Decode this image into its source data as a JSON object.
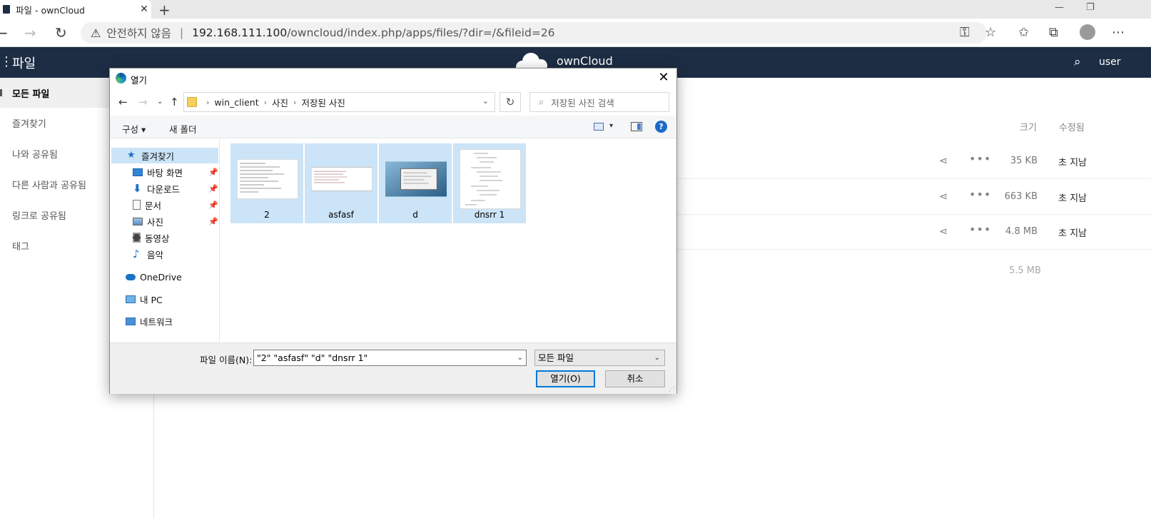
{
  "browser": {
    "tab_title": "파일 - ownCloud",
    "close_tab": "✕",
    "new_tab": "+",
    "security_label": "안전하지 않음",
    "url_host": "192.168.111.100",
    "url_path": "/owncloud/index.php/apps/files/?dir=/&fileid=26"
  },
  "app": {
    "title": "파일",
    "brand": "ownCloud",
    "user": "user",
    "colors": {
      "header": "#1d2d44",
      "accent": "#0078d7"
    }
  },
  "sidebar": {
    "items": [
      {
        "label": "모든 파일",
        "active": true
      },
      {
        "label": "즐겨찾기"
      },
      {
        "label": "나와 공유됨"
      },
      {
        "label": "다른 사람과 공유됨"
      },
      {
        "label": "링크로 공유됨"
      },
      {
        "label": "태그"
      }
    ]
  },
  "files_table": {
    "columns": {
      "size": "크기",
      "modified": "수정됨"
    },
    "rows": [
      {
        "size": "35 KB",
        "modified": "초 지남"
      },
      {
        "size": "663 KB",
        "modified": "초 지남"
      },
      {
        "size": "4.8 MB",
        "modified": "초 지남"
      }
    ],
    "total_size": "5.5 MB"
  },
  "dialog": {
    "title": "열기",
    "close": "✕",
    "breadcrumb": [
      "win_client",
      "사진",
      "저장된 사진"
    ],
    "search_placeholder": "저장된 사진 검색",
    "toolbar": {
      "organize": "구성 ▾",
      "new_folder": "새 폴더",
      "help": "?"
    },
    "tree": {
      "quick_access": "즐겨찾기",
      "items": [
        "바탕 화면",
        "다운로드",
        "문서",
        "사진",
        "동영상",
        "음악"
      ],
      "onedrive": "OneDrive",
      "this_pc": "내 PC",
      "network": "네트워크"
    },
    "files": [
      "2",
      "asfasf",
      "d",
      "dnsrr 1"
    ],
    "file_name_label": "파일 이름(N):",
    "file_name_value": "\"2\" \"asfasf\" \"d\" \"dnsrr 1\"",
    "file_type": "모든 파일",
    "open_button": "열기(O)",
    "cancel_button": "취소"
  }
}
